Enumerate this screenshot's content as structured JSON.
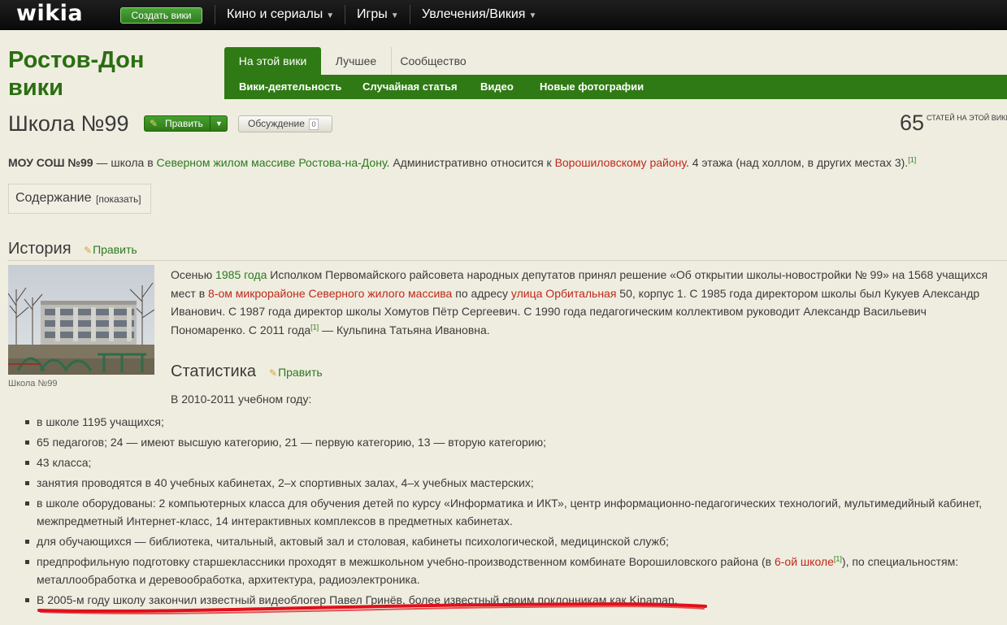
{
  "topbar": {
    "logo": "wikia",
    "create_wiki": "Создать вики",
    "nav": [
      {
        "label": "Кино и сериалы"
      },
      {
        "label": "Игры"
      },
      {
        "label": "Увлечения/Викия"
      }
    ]
  },
  "wiki": {
    "name_line1": "Ростов-Дон",
    "name_line2": "вики",
    "tabs": [
      "На этой вики",
      "Лучшее",
      "Сообщество"
    ],
    "subnav": [
      "Вики-деятельность",
      "Случайная статья",
      "Видео",
      "Новые фотографии"
    ]
  },
  "article": {
    "title": "Школа №99",
    "edit_label": "Править",
    "talk_label": "Обсуждение",
    "talk_count": "0",
    "article_count": "65",
    "article_count_label": "СТАТЕЙ НА ЭТОЙ ВИКИ",
    "intro": {
      "bold": "МОУ СОШ №99",
      "t1": " — школа в ",
      "link1": "Северном жилом массиве Ростова-на-Дону",
      "t2": ". Административно относится к ",
      "link2": "Ворошиловскому району",
      "t3": ". 4 этажа (над холлом, в других местах 3).",
      "ref": "[1]"
    },
    "toc": {
      "title": "Содержание",
      "toggle": "[показать]"
    },
    "history": {
      "heading": "История",
      "edit": "Править",
      "caption": "Школа №99",
      "p1_a": "Осенью ",
      "p1_link1": "1985 года",
      "p1_b": " Исполком Первомайского райсовета народных депутатов принял решение «Об открытии школы-новостройки № 99» на 1568 учащихся",
      "p2_a": "мест в ",
      "p2_link1": "8-ом микрорайоне Северного жилого массива",
      "p2_b": " по адресу ",
      "p2_link2": "улица Орбитальная",
      "p2_c": " 50, корпус 1. С 1985 года директором школы был Кукуев Александр",
      "p3": "Иванович. С 1987 года директор школы Хомутов Пётр Сергеевич. С 1990 года педагогическим коллективом руководит Александр Васильевич",
      "p4_a": "Пономаренко. С 2011 года",
      "p4_ref": "[1]",
      "p4_b": " — Кульпина Татьяна Ивановна."
    },
    "stats": {
      "heading": "Статистика",
      "edit": "Править",
      "intro": "В 2010-2011 учебном году:",
      "items": [
        "в школе 1195 учащихся;",
        "65 педагогов; 24 — имеют высшую категорию, 21 — первую категорию, 13 — вторую категорию;",
        "43 класса;",
        "занятия проводятся в 40 учебных кабинетах, 2–х спортивных залах, 4–х учебных мастерских;",
        "в школе оборудованы: 2 компьютерных класса для обучения детей по курсу «Информатика и ИКТ», центр информационно-педагогических технологий, мультимедийный кабинет,",
        "межпредметный Интернет-класс, 14 интерактивных комплексов в предметных кабинетах.",
        "для обучающихся — библиотека, читальный, актовый зал и столовая, кабинеты психологической, медицинской служб;",
        "предпрофильную подготовку старшеклассники проходят в межшкольном учебно-производственном комбинате Ворошиловского района (в ",
        "6-ой школе",
        "[1]",
        "), по специальностям:",
        "металлообработка и деревообработка, архитектура, радиоэлектроника.",
        "В 2005-м году школу закончил известный видеоблогер Павел Гринёв, более известный своим поклонникам как Kinaman."
      ]
    }
  },
  "colors": {
    "background": "#efede0",
    "brand_green": "#2f7a14",
    "link_green": "#2b7a1f",
    "redlink": "#c0281a",
    "annotation_red": "#e0101a"
  }
}
